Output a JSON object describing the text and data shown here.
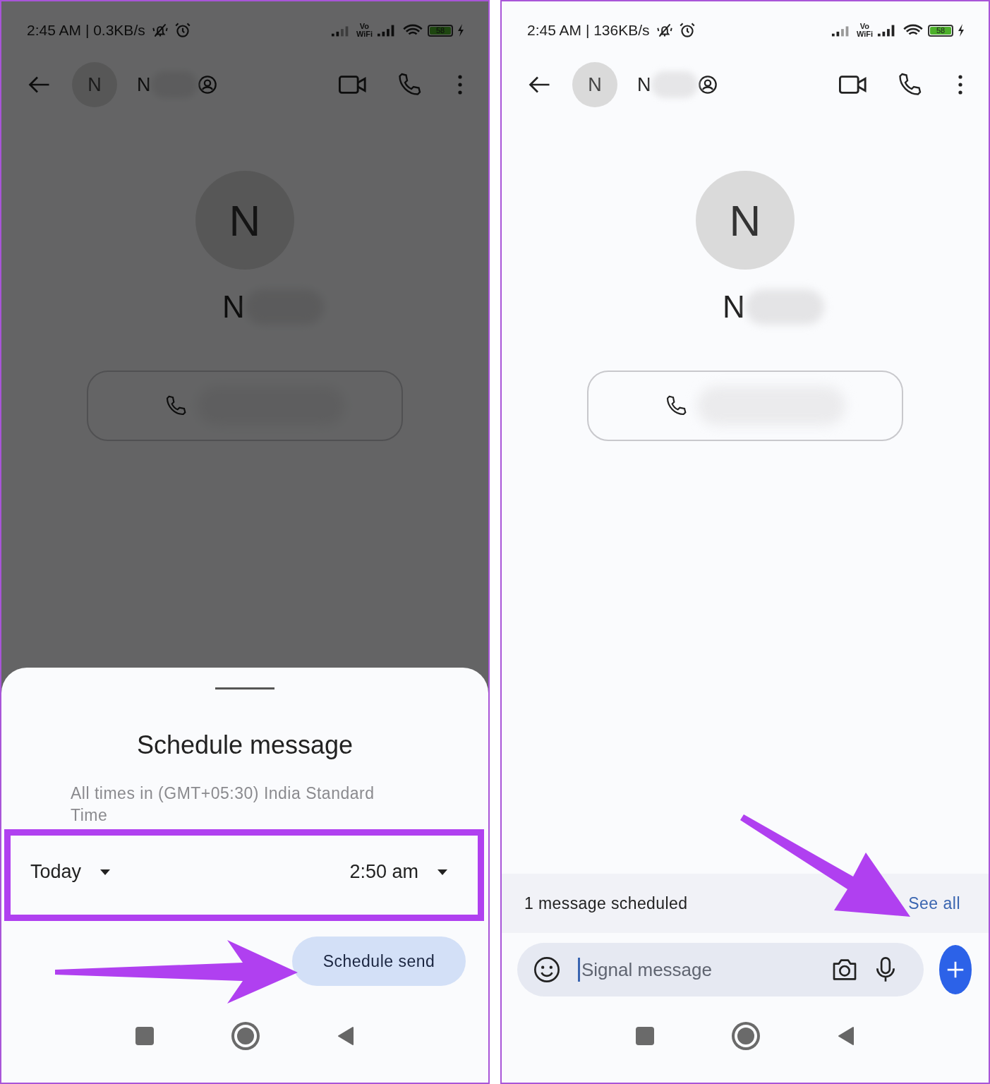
{
  "screens": [
    {
      "kind": "schedule_sheet",
      "dimmed": true,
      "status_bar": {
        "time": "2:45 AM | 0.3KB/s",
        "vowifi": [
          "Vo",
          "WiFi"
        ],
        "battery": "58"
      },
      "header": {
        "avatar": "N",
        "name": "N"
      },
      "profile": {
        "avatar": "N",
        "name": "N"
      },
      "sheet": {
        "title": "Schedule message",
        "note": "All times in (GMT+05:30) India Standard Time",
        "date": "Today",
        "time": "2:50 am",
        "button": "Schedule send"
      }
    },
    {
      "kind": "conversation",
      "dimmed": false,
      "status_bar": {
        "time": "2:45 AM | 136KB/s",
        "vowifi": [
          "Vo",
          "WiFi"
        ],
        "battery": "58"
      },
      "header": {
        "avatar": "N",
        "name": "N"
      },
      "profile": {
        "avatar": "N",
        "name": "N"
      },
      "scheduled_bar": {
        "text": "1 message scheduled",
        "link": "See all"
      },
      "composer": {
        "placeholder": "Signal message"
      }
    }
  ]
}
